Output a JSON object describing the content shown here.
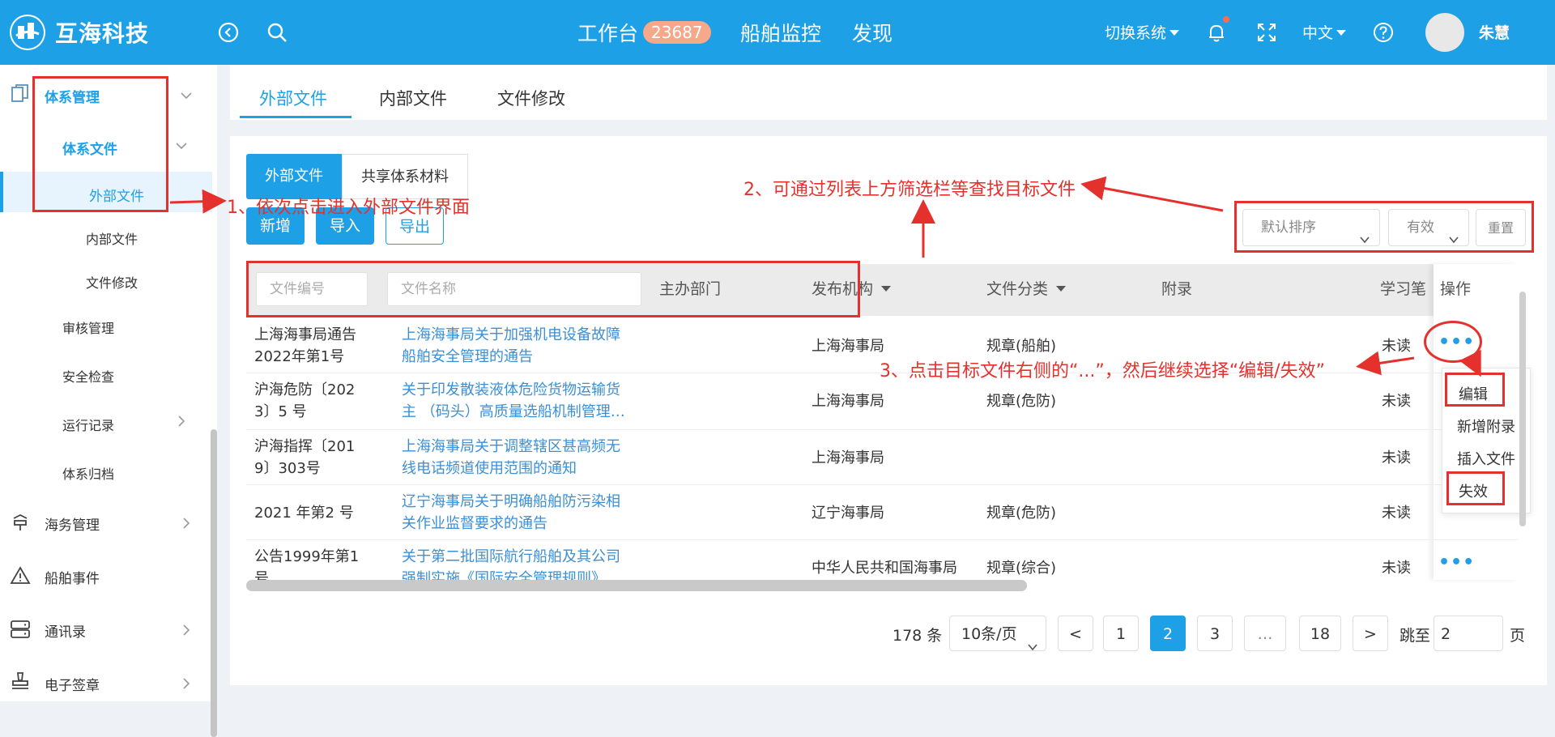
{
  "topbar": {
    "brand": "互海科技",
    "nav": {
      "workbench": "工作台",
      "workbench_badge": "23687",
      "ship_monitor": "船舶监控",
      "discover": "发现"
    },
    "switch_system": "切换系统",
    "language": "中文",
    "username": "朱慧"
  },
  "sidebar": {
    "system_mgmt": "体系管理",
    "system_files": "体系文件",
    "external_files": "外部文件",
    "internal_files": "内部文件",
    "file_revision": "文件修改",
    "audit_mgmt": "审核管理",
    "safety_check": "安全检查",
    "operation_records": "运行记录",
    "system_archive": "体系归档",
    "maritime_mgmt": "海务管理",
    "ship_events": "船舶事件",
    "contacts": "通讯录",
    "e_seal": "电子签章"
  },
  "tabs": {
    "external": "外部文件",
    "internal": "内部文件",
    "revision": "文件修改"
  },
  "subtabs": {
    "external": "外部文件",
    "shared": "共享体系材料"
  },
  "buttons": {
    "add": "新增",
    "import": "导入",
    "export": "导出",
    "reset": "重置"
  },
  "filters": {
    "sort": "默认排序",
    "status": "有效",
    "file_no_placeholder": "文件编号",
    "file_name_placeholder": "文件名称"
  },
  "table": {
    "headers": {
      "dept": "主办部门",
      "issuer": "发布机构",
      "category": "文件分类",
      "appendix": "附录",
      "study": "学习笔",
      "op": "操作"
    },
    "rows": [
      {
        "no1": "上海海事局通告",
        "no2": "2022年第1号",
        "name1": "上海海事局关于加强机电设备故障",
        "name2": "船舶安全管理的通告",
        "issuer": "上海海事局",
        "category": "规章(船舶)",
        "study": "未读"
      },
      {
        "no1": "沪海危防〔202",
        "no2": "3〕5 号",
        "name1": "关于印发散装液体危险货物运输货",
        "name2": "主 （码头）高质量选船机制管理…",
        "issuer": "上海海事局",
        "category": "规章(危防)",
        "study": "未读"
      },
      {
        "no1": "沪海指挥〔201",
        "no2": "9〕303号",
        "name1": "上海海事局关于调整辖区甚高频无",
        "name2": "线电话频道使用范围的通知",
        "issuer": "上海海事局",
        "category": "",
        "study": "未读"
      },
      {
        "no1": "2021 年第2 号",
        "no2": "",
        "name1": "辽宁海事局关于明确船舶防污染相",
        "name2": "关作业监督要求的通告",
        "issuer": "辽宁海事局",
        "category": "规章(危防)",
        "study": "未读"
      },
      {
        "no1": "公告1999年第1",
        "no2": "号",
        "name1": "关于第二批国际航行船舶及其公司",
        "name2": "强制实施《国际安全管理规则》",
        "issuer": "中华人民共和国海事局",
        "category": "规章(综合)",
        "study": "未读"
      }
    ],
    "more": "•••"
  },
  "menu": {
    "edit": "编辑",
    "add_appendix": "新增附录",
    "insert_file": "插入文件",
    "invalidate": "失效"
  },
  "pagination": {
    "total": "178 条",
    "page_size": "10条/页",
    "prev": "<",
    "p1": "1",
    "p2": "2",
    "p3": "3",
    "ellipsis": "…",
    "p18": "18",
    "next": ">",
    "jump_label": "跳至",
    "jump_value": "2",
    "page_unit": "页"
  },
  "annotations": {
    "step1": "1、依次点击进入外部文件界面",
    "step2": "2、可通过列表上方筛选栏等查找目标文件",
    "step3": "3、点击目标文件右侧的“...”，然后继续选择“编辑/失效”"
  },
  "colors": {
    "primary": "#1ea0e6",
    "annotation": "#e5312d",
    "link": "#3b8fd6"
  }
}
